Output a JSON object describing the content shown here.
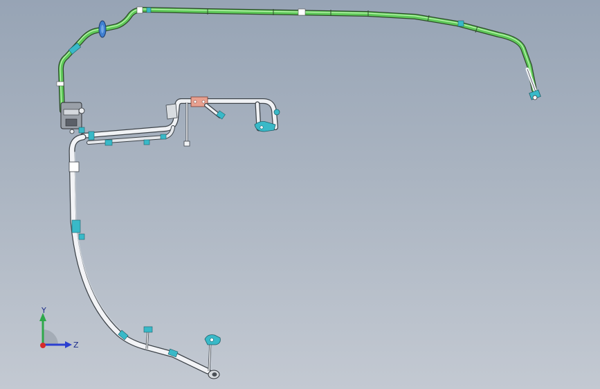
{
  "viewport": {
    "background_top": "#97a4b5",
    "background_bottom": "#c3c9d2",
    "colors": {
      "green_pipe": "#5fc95a",
      "white_pipe": "#f0f2f5",
      "pipe_outline": "#3c4a3a",
      "clamp_cyan": "#39b9c8",
      "bracket_blue": "#3f7fd0",
      "flange_pink": "#e8a08f"
    }
  },
  "triad": {
    "y_label": "Y",
    "z_label": "Z",
    "y_color": "#2ea84a",
    "z_color": "#2b3fd0",
    "x_color": "#d62a2a"
  }
}
